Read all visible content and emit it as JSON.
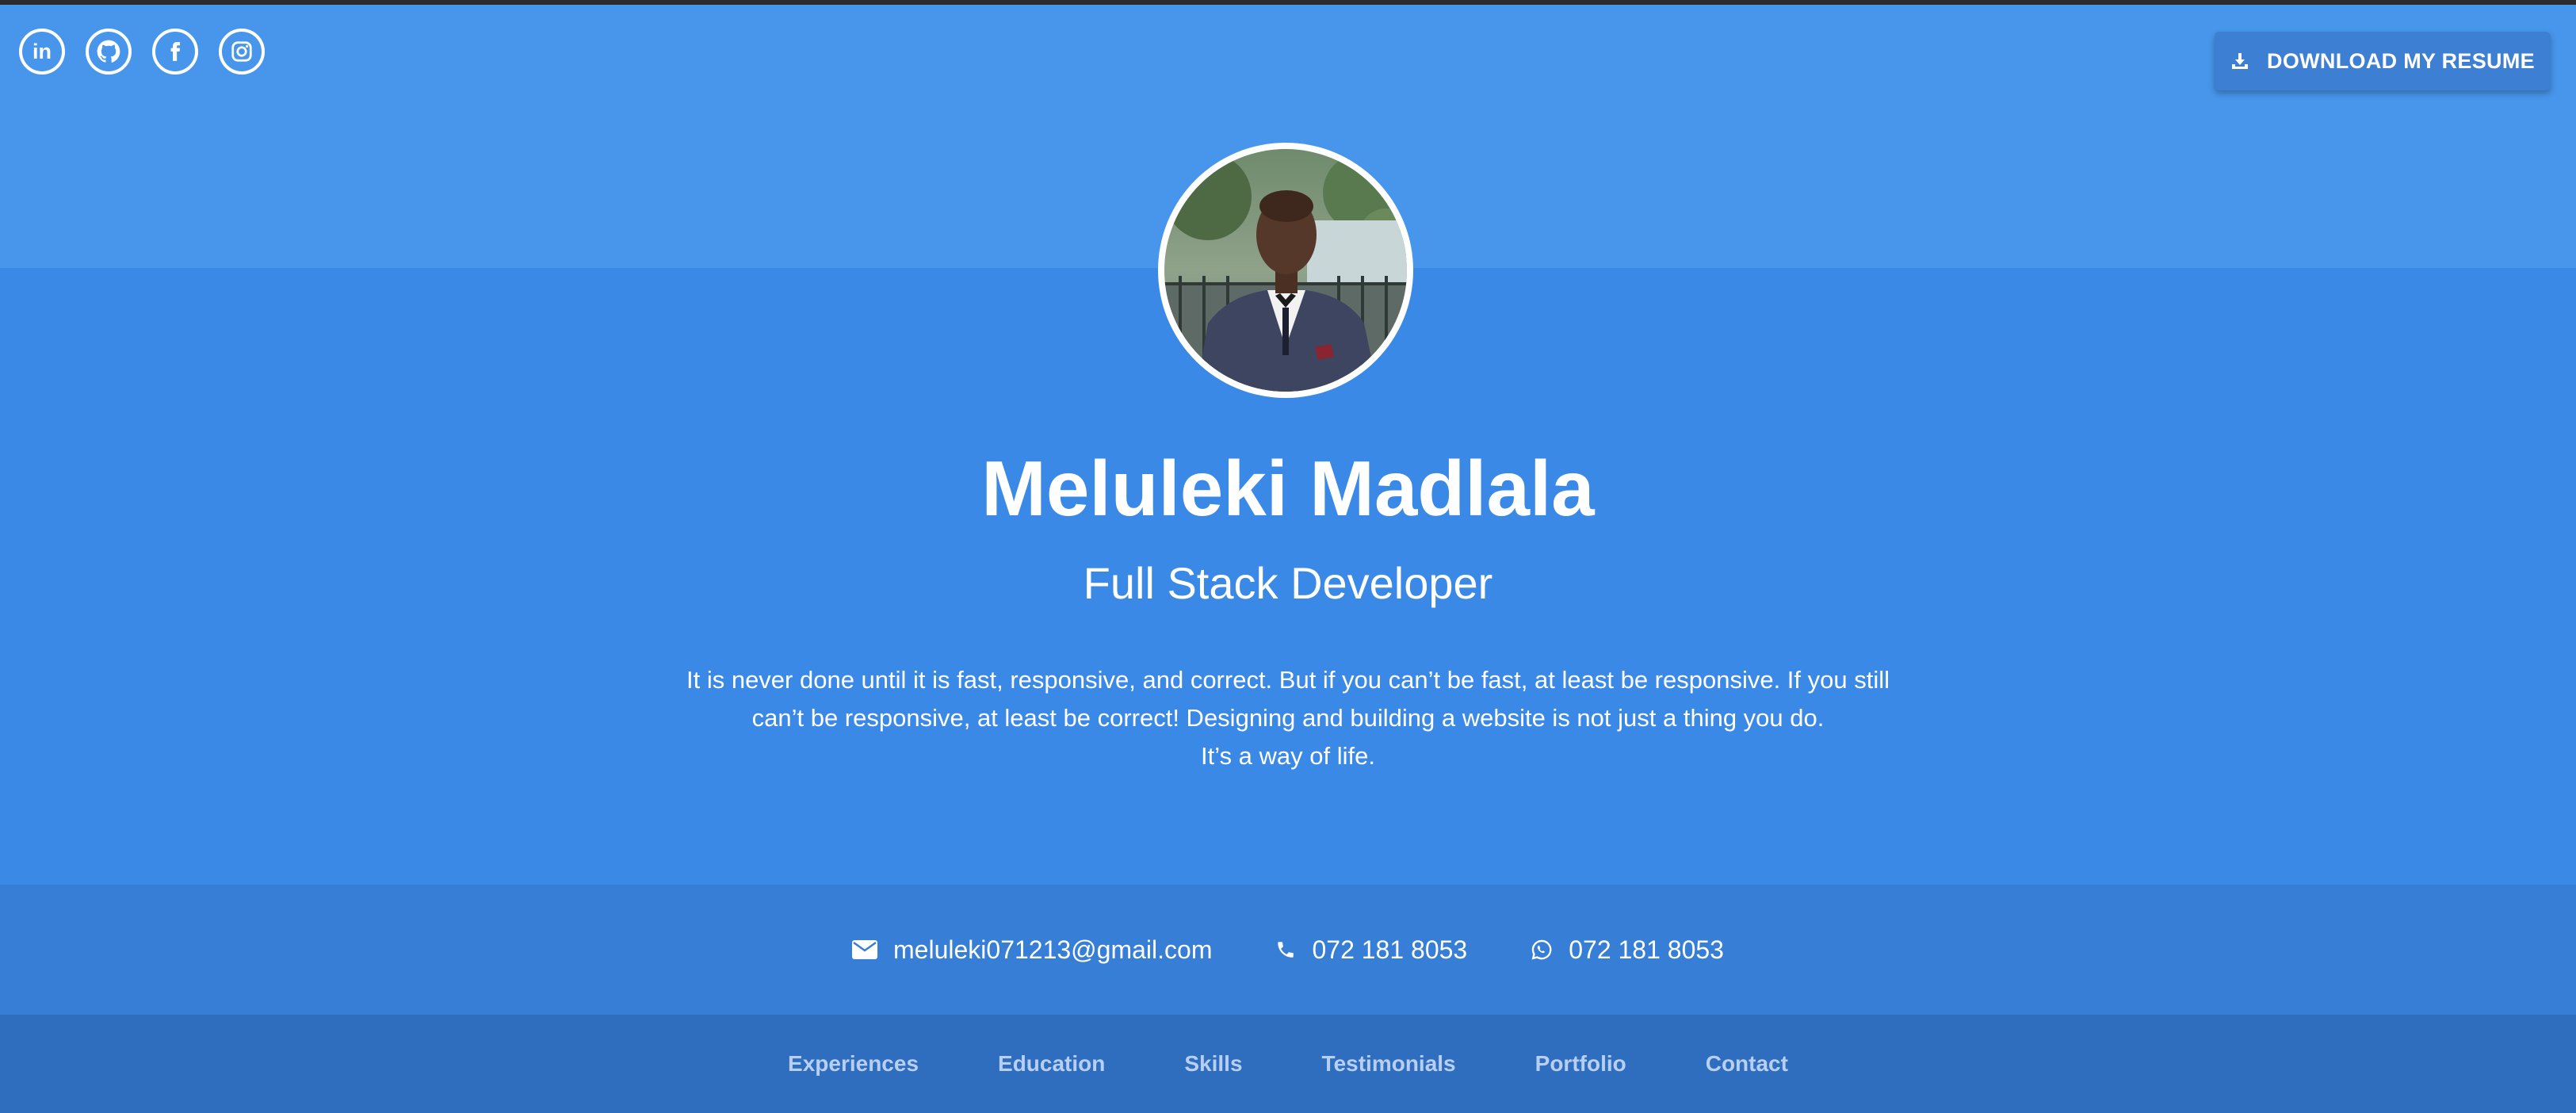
{
  "social": {
    "icons": [
      "linkedin-icon",
      "github-icon",
      "facebook-icon",
      "instagram-icon"
    ],
    "linkedin_glyph": "in"
  },
  "header": {
    "download_label": "DOWNLOAD MY RESUME",
    "download_icon": "download-icon"
  },
  "profile": {
    "name": "Meluleki Madlala",
    "role": "Full Stack Developer",
    "tagline": [
      "It is never done until it is fast, responsive, and correct. But if you can’t be fast, at least be responsive. If you still",
      "can’t be responsive, at least be correct! Designing and building a website is not just a thing you do.",
      "It’s a way of life."
    ]
  },
  "contact": {
    "email": "meluleki071213@gmail.com",
    "phone": "072 181 8053",
    "whatsapp": "072 181 8053",
    "icons": [
      "envelope-icon",
      "phone-icon",
      "whatsapp-icon"
    ]
  },
  "nav": {
    "items": [
      "Experiences",
      "Education",
      "Skills",
      "Testimonials",
      "Portfolio",
      "Contact"
    ]
  },
  "colors": {
    "primary": "#3b89e6",
    "top_band": "#4796eb",
    "contact_bar": "#367ed6",
    "nav_bar": "#2f6dbe",
    "button": "#3d7fd3",
    "nav_text": "#b7cff2"
  }
}
